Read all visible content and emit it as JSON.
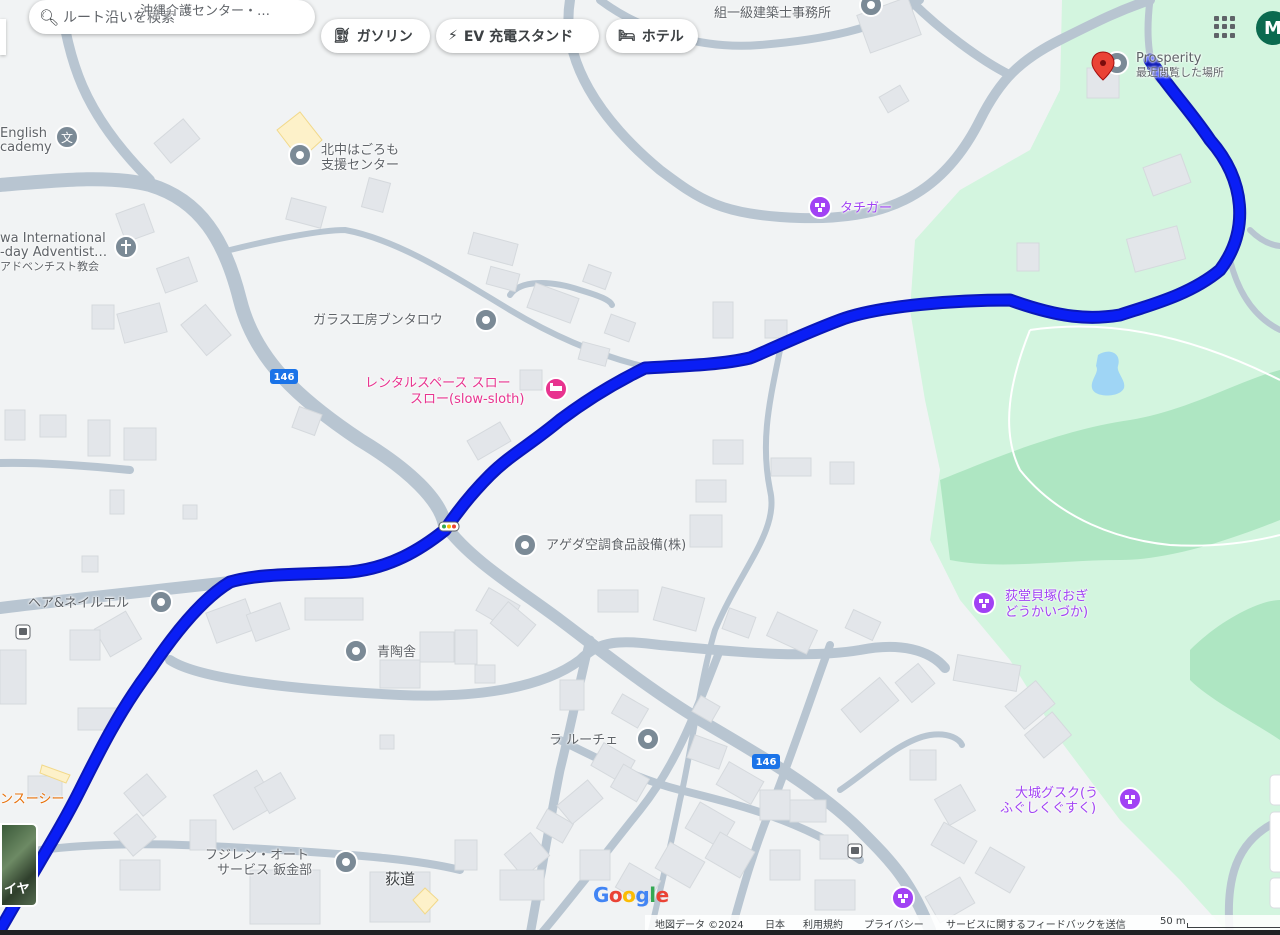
{
  "search": {
    "placeholder": "ルート沿いを検索",
    "icon": "search-icon"
  },
  "chips": [
    {
      "label": "ガソリン",
      "icon": "gas-station-icon"
    },
    {
      "label": "EV 充電スタンド",
      "icon": "ev-charger-icon"
    },
    {
      "label": "ホテル",
      "icon": "hotel-icon"
    }
  ],
  "header": {
    "apps_icon": "apps-grid-icon",
    "avatar_letter": "M"
  },
  "places": {
    "top_cut_1": "沖縄介護センター・…",
    "top_cut_2": "組一級建築士事務所",
    "english_1": "English",
    "english_2": "cademy",
    "kitanaka_1": "北中はごろも",
    "kitanaka_2": "支援センター",
    "church_1": "wa International",
    "church_2": "-day Adventist…",
    "church_3": "アドベンチスト教会",
    "tachigar": "タチガー",
    "prosperity": "Prosperity",
    "prosperity_sub": "最近閲覧した場所",
    "glass": "ガラス工房ブンタロウ",
    "rental_1": "レンタルスペース スロー",
    "rental_2": "スロー(slow-sloth)",
    "ageda": "アゲダ空調食品設備(株)",
    "hair": "ヘア&ネイルエル",
    "seitousha": "青陶舎",
    "ogido_1": "荻堂貝塚(おぎ",
    "ogido_2": "どうかいづか)",
    "laruche": "ラ ルーチェ",
    "gusuku_1": "大城グスク(う",
    "gusuku_2": "ふぐしくぐすく)",
    "fujiren_1": "フジレン・オート",
    "fujiren_2": "サービス 鈑金部",
    "ogido_area": "荻道",
    "orange_cut": "ンスーシー"
  },
  "road_shields": [
    "146",
    "146"
  ],
  "layer_thumb_label": "イヤ",
  "branding": "Google",
  "footer": {
    "map_data": "地図データ ©2024",
    "country": "日本",
    "terms": "利用規約",
    "privacy": "プライバシー",
    "feedback": "サービスに関するフィードバックを送信",
    "scale": "50 m"
  },
  "colors": {
    "route": "#0a1ef5",
    "route_outline": "#0a17b8",
    "park": "#d3f5df",
    "road": "#b8c5d1",
    "poi_gray": "#7b8a96",
    "poi_purple": "#a142f4",
    "poi_pink": "#e8338f",
    "pin_red": "#ea4335"
  }
}
